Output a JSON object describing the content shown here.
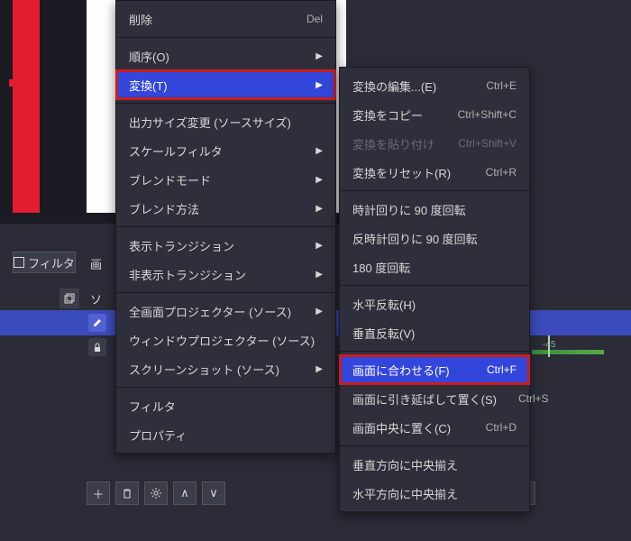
{
  "canvas": {
    "filter_button": "フィルタ",
    "partial_label": "画"
  },
  "panel": {
    "so_label": "ソ",
    "timeline_tick": "-45"
  },
  "toolbar": {
    "add": "＋",
    "up": "∧",
    "down": "∨"
  },
  "main_menu": [
    {
      "label": "削除",
      "shortcut": "Del",
      "arrow": false
    },
    {
      "sep": true
    },
    {
      "label": "順序(O)",
      "shortcut": "",
      "arrow": true
    },
    {
      "label": "変換(T)",
      "shortcut": "",
      "arrow": true,
      "highlight": true,
      "redbox": true
    },
    {
      "sep": true
    },
    {
      "label": "出力サイズ変更 (ソースサイズ)",
      "shortcut": "",
      "arrow": false
    },
    {
      "label": "スケールフィルタ",
      "shortcut": "",
      "arrow": true
    },
    {
      "label": "ブレンドモード",
      "shortcut": "",
      "arrow": true
    },
    {
      "label": "ブレンド方法",
      "shortcut": "",
      "arrow": true
    },
    {
      "sep": true
    },
    {
      "label": "表示トランジション",
      "shortcut": "",
      "arrow": true
    },
    {
      "label": "非表示トランジション",
      "shortcut": "",
      "arrow": true
    },
    {
      "sep": true
    },
    {
      "label": "全画面プロジェクター (ソース)",
      "shortcut": "",
      "arrow": true
    },
    {
      "label": "ウィンドウプロジェクター (ソース)",
      "shortcut": "",
      "arrow": false
    },
    {
      "label": "スクリーンショット (ソース)",
      "shortcut": "",
      "arrow": true
    },
    {
      "sep": true
    },
    {
      "label": "フィルタ",
      "shortcut": "",
      "arrow": false
    },
    {
      "label": "プロパティ",
      "shortcut": "",
      "arrow": false
    }
  ],
  "sub_menu": [
    {
      "label": "変換の編集...(E)",
      "shortcut": "Ctrl+E"
    },
    {
      "label": "変換をコピー",
      "shortcut": "Ctrl+Shift+C"
    },
    {
      "label": "変換を貼り付け",
      "shortcut": "Ctrl+Shift+V",
      "disabled": true
    },
    {
      "label": "変換をリセット(R)",
      "shortcut": "Ctrl+R"
    },
    {
      "sep": true
    },
    {
      "label": "時計回りに 90 度回転",
      "shortcut": ""
    },
    {
      "label": "反時計回りに 90 度回転",
      "shortcut": ""
    },
    {
      "label": "180 度回転",
      "shortcut": ""
    },
    {
      "sep": true
    },
    {
      "label": "水平反転(H)",
      "shortcut": ""
    },
    {
      "label": "垂直反転(V)",
      "shortcut": ""
    },
    {
      "sep": true
    },
    {
      "label": "画面に合わせる(F)",
      "shortcut": "Ctrl+F",
      "highlight": true,
      "redbox": true
    },
    {
      "label": "画面に引き延ばして置く(S)",
      "shortcut": "Ctrl+S"
    },
    {
      "label": "画面中央に置く(C)",
      "shortcut": "Ctrl+D"
    },
    {
      "sep": true
    },
    {
      "label": "垂直方向に中央揃え",
      "shortcut": ""
    },
    {
      "label": "水平方向に中央揃え",
      "shortcut": ""
    }
  ]
}
